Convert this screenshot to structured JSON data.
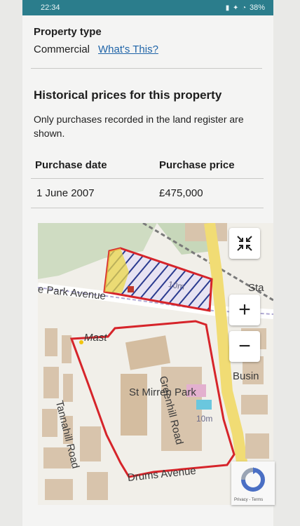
{
  "status_bar": {
    "time": "22:34",
    "battery": "38%"
  },
  "property": {
    "type_label": "Property type",
    "type_value": "Commercial",
    "help_link": "What's This?"
  },
  "history": {
    "title": "Historical prices for this property",
    "note": "Only purchases recorded in the land register are shown.",
    "columns": [
      "Purchase date",
      "Purchase price"
    ],
    "rows": [
      {
        "date": "1 June 2007",
        "price": "£475,000"
      }
    ]
  },
  "map": {
    "labels": {
      "park_avenue": "e Park Avenue",
      "mast": "Mast",
      "stadium": "St Mirren Park",
      "greenhill": "Greenhill Road",
      "tannahill": "Tannahill Road",
      "drums": "Drums Avenue",
      "sta": "Sta",
      "busin": "Busin",
      "ten_m_a": "10m",
      "ten_m_b": "10m"
    },
    "controls": {
      "zoom_in": "+",
      "zoom_out": "−"
    },
    "boundary_color": "#d6242a",
    "hatch_color": "#2a3a8f"
  },
  "recaptcha": {
    "text": "Privacy - Terms"
  }
}
